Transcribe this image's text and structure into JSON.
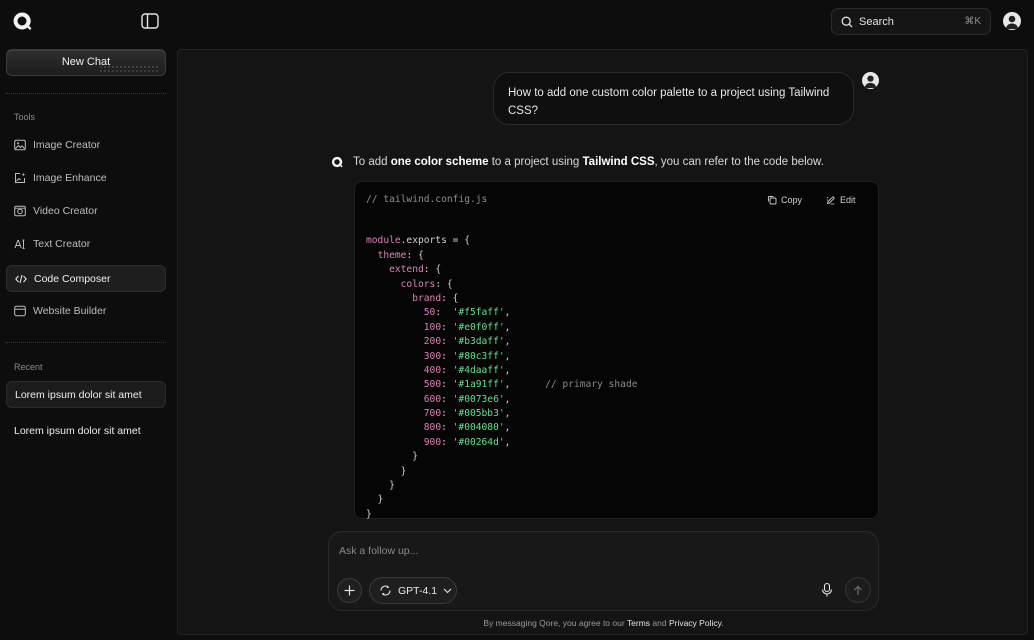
{
  "header": {
    "search_label": "Search",
    "search_shortcut": "⌘K"
  },
  "sidebar": {
    "new_chat_label": "New Chat",
    "tools_label": "Tools",
    "tools": [
      {
        "label": "Image Creator",
        "icon": "image-icon"
      },
      {
        "label": "Image Enhance",
        "icon": "image-enhance-icon"
      },
      {
        "label": "Video Creator",
        "icon": "video-icon"
      },
      {
        "label": "Text Creator",
        "icon": "text-icon"
      },
      {
        "label": "Code Composer",
        "icon": "code-icon",
        "active": true
      },
      {
        "label": "Website Builder",
        "icon": "browser-icon"
      }
    ],
    "recent_label": "Recent",
    "recent": [
      {
        "label": "Lorem ipsum dolor sit amet",
        "active": true
      },
      {
        "label": "Lorem ipsum dolor sit amet",
        "active": false
      }
    ]
  },
  "chat": {
    "user_message": "How to add one custom color palette to a project using Tailwind CSS?",
    "bot_intro": {
      "part1": "To add ",
      "bold1": "one color scheme",
      "part2": " to a project using ",
      "bold2": "Tailwind CSS",
      "part3": ", you can refer to the code below."
    },
    "code": {
      "filename": "// tailwind.config.js",
      "copy_label": "Copy",
      "edit_label": "Edit",
      "lines": [
        "",
        "module.exports = {",
        "  theme: {",
        "    extend: {",
        "      colors: {",
        "        brand: {",
        "          50:  '#f5faff',",
        "          100: '#e0f0ff',",
        "          200: '#b3daff',",
        "          300: '#80c3ff',",
        "          400: '#4daaff',",
        "          500: '#1a91ff',      // primary shade",
        "          600: '#0073e6',",
        "          700: '#005bb3',",
        "          800: '#004080',",
        "          900: '#00264d',",
        "        }",
        "      }",
        "    }",
        "  }",
        "}"
      ]
    }
  },
  "composer": {
    "placeholder": "Ask a follow up...",
    "model_label": "GPT-4.1"
  },
  "footer": {
    "prefix": "By messaging Qore, you agree to our ",
    "terms": "Terms",
    "and": " and ",
    "privacy": "Privacy Policy",
    "suffix": "."
  },
  "colors": {
    "background": "#0d0d0d",
    "panel": "#141414",
    "keyword": "#e07fb8",
    "string": "#5fe08c",
    "comment": "#8a8a8a"
  }
}
